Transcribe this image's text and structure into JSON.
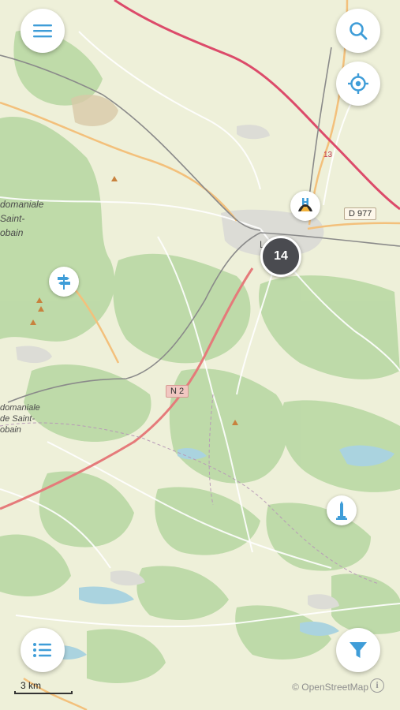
{
  "map": {
    "labels": {
      "forest_north_1": "domaniale",
      "forest_north_2": "Saint-",
      "forest_north_3": "obain",
      "forest_south_1": "domaniale",
      "forest_south_2": "de Saint-",
      "forest_south_3": "obain",
      "town_initial": "L"
    },
    "road_shields": {
      "d977": "D 977",
      "n2": "N 2",
      "road13": "13"
    },
    "cluster_count": "14"
  },
  "controls": {
    "menu_icon": "hamburger-menu-icon",
    "search_icon": "search-icon",
    "locate_icon": "crosshair-locate-icon",
    "list_icon": "list-icon",
    "filter_icon": "filter-funnel-icon"
  },
  "poi_icons": [
    "signpost-icon",
    "observatory-icon",
    "monument-obelisk-icon"
  ],
  "scale": {
    "label": "3 km"
  },
  "attribution": {
    "text": "© OpenStreetMap"
  },
  "colors": {
    "accent": "#3f9dd8",
    "cluster": "#4a4b50",
    "map_background": "#eef0d9",
    "forest": "#bcd9a7",
    "national_road": "#e57a7a",
    "railway_red": "#dc4b6a"
  }
}
